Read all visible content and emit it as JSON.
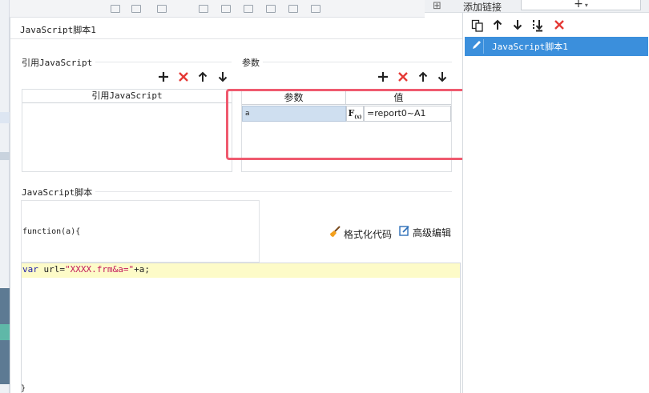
{
  "background": {
    "right_header": {
      "add_link_label": "添加链接",
      "add_button_label": "+",
      "add_button_caret": "▾"
    },
    "code_tail": "}"
  },
  "dialog": {
    "title": "JavaScript脚本1",
    "references": {
      "section_label": "引用JavaScript",
      "column_header": "引用JavaScript"
    },
    "parameters": {
      "section_label": "参数",
      "columns": [
        "参数",
        "值"
      ],
      "rows": [
        {
          "name": "a",
          "formula_label": "F",
          "formula_sub": "(x)",
          "value": "=report0~A1"
        }
      ]
    },
    "script": {
      "section_label": "JavaScript脚本",
      "function_signature": "function(a){",
      "format_label": "格式化代码",
      "advanced_label": "高级编辑",
      "code": {
        "keyword": "var",
        "identifier": " url=",
        "string": "\"XXXX.frm&a=\"",
        "tail": "+a;"
      }
    },
    "icons": {
      "add": "plus-icon",
      "delete": "delete-x-icon",
      "up": "arrow-up-icon",
      "down": "arrow-down-icon"
    }
  },
  "right_panel": {
    "items": [
      {
        "label": "JavaScript脚本1",
        "selected": true
      }
    ]
  },
  "colors": {
    "accent": "#3b8fdc",
    "delete": "#e53935",
    "highlight_box": "#ef5a6f",
    "code_line_bg": "#fdfbc8",
    "param_cell_bg": "#cfdff0"
  }
}
